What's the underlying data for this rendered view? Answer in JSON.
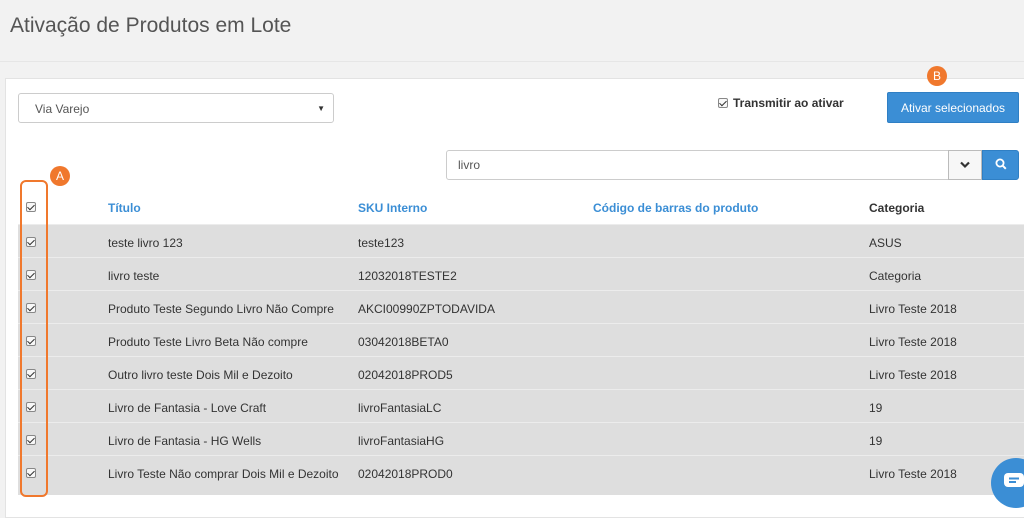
{
  "page": {
    "title": "Ativação de Produtos em Lote"
  },
  "filters": {
    "store": "Via Varejo",
    "transmit_label": "Transmitir ao ativar",
    "transmit_checked": true,
    "activate_button": "Ativar selecionados",
    "search_value": "livro"
  },
  "annotations": {
    "badge_a": "A",
    "badge_b": "B",
    "accent_color": "#f0782d"
  },
  "table": {
    "columns": {
      "title": "Título",
      "sku": "SKU Interno",
      "barcode": "Código de barras do produto",
      "category": "Categoria"
    },
    "rows": [
      {
        "title": "teste livro 123",
        "sku": "teste123",
        "barcode": "",
        "category": "ASUS"
      },
      {
        "title": "livro teste",
        "sku": "12032018TESTE2",
        "barcode": "",
        "category": "Categoria"
      },
      {
        "title": "Produto Teste Segundo Livro Não Compre",
        "sku": "AKCI00990ZPTODAVIDA",
        "barcode": "",
        "category": "Livro Teste 2018"
      },
      {
        "title": "Produto Teste Livro Beta Não compre",
        "sku": "03042018BETA0",
        "barcode": "",
        "category": "Livro Teste 2018"
      },
      {
        "title": "Outro livro teste Dois Mil e Dezoito",
        "sku": "02042018PROD5",
        "barcode": "",
        "category": "Livro Teste 2018"
      },
      {
        "title": "Livro de Fantasia - Love Craft",
        "sku": "livroFantasiaLC",
        "barcode": "",
        "category": "19"
      },
      {
        "title": "Livro de Fantasia - HG Wells",
        "sku": "livroFantasiaHG",
        "barcode": "",
        "category": "19"
      },
      {
        "title": "Livro Teste Não comprar Dois Mil e Dezoito",
        "sku": "02042018PROD0",
        "barcode": "",
        "category": "Livro Teste 2018"
      }
    ]
  },
  "colors": {
    "primary": "#3b8ed5",
    "row_background": "#dedede"
  },
  "icons": {
    "search": "search-icon",
    "dropdown": "chevron-down-icon",
    "chat": "chat-icon"
  }
}
